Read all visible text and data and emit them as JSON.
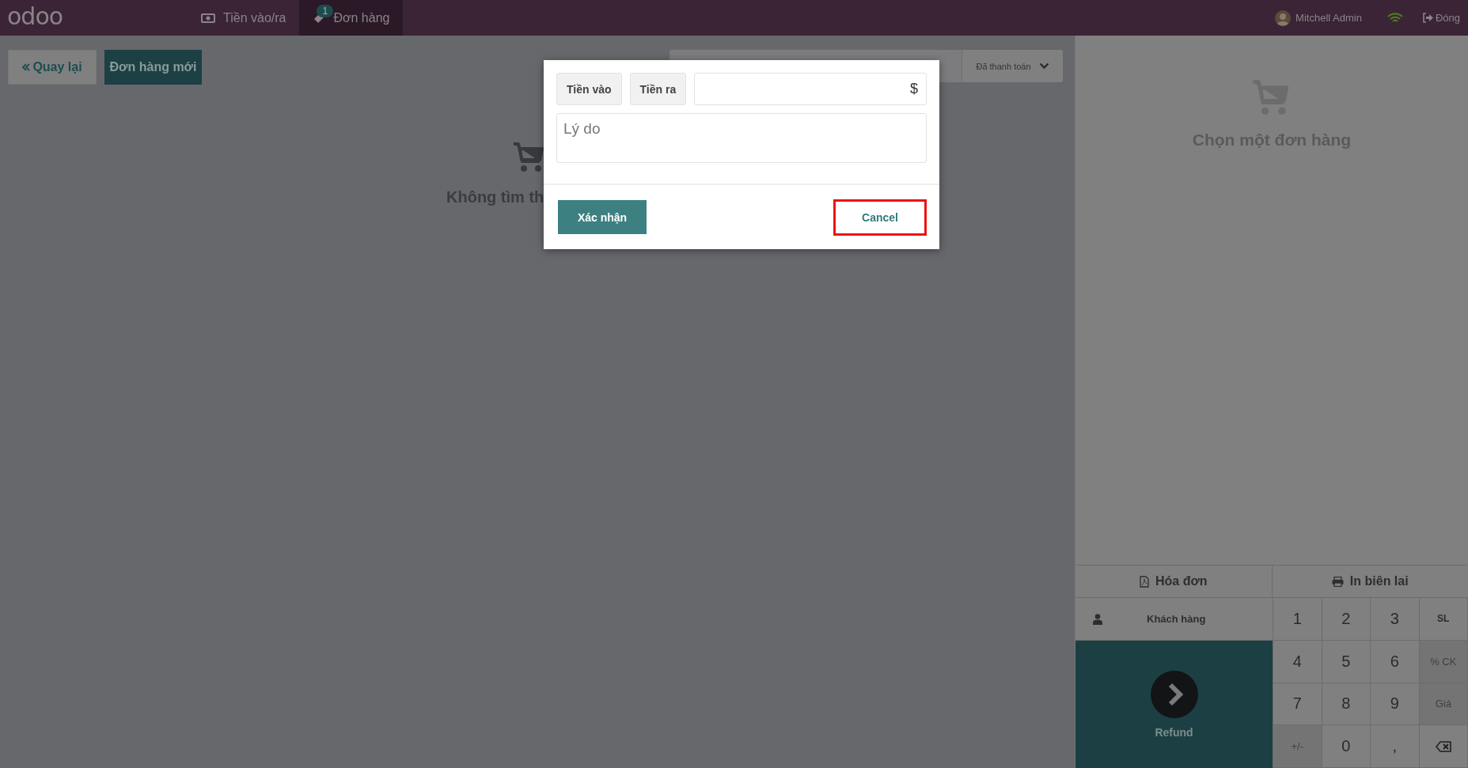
{
  "navbar": {
    "logo": "odoo",
    "items": [
      {
        "kind": "cash",
        "label": "Tiền vào/ra",
        "selected": false
      },
      {
        "kind": "orders",
        "label": "Đơn hàng",
        "badge": "1",
        "selected": true
      }
    ],
    "user": "Mitchell Admin",
    "close": "Đóng"
  },
  "toolbar": {
    "back": "Quay lại",
    "new_order": "Đơn hàng mới",
    "filter": "Đã thanh toán"
  },
  "order_list": {
    "empty_text": "Không tìm th"
  },
  "dialog": {
    "buttons": [
      {
        "label": "Tiền vào"
      },
      {
        "label": "Tiền ra"
      }
    ],
    "currency": "$",
    "reason_placeholder": "Lý do",
    "confirm": "Xác nhận",
    "cancel": "Cancel",
    "cancel_highlighted": true
  },
  "detail": {
    "empty_text": "Chọn một đơn hàng"
  },
  "actions": {
    "invoice": "Hóa đơn",
    "print": "In biên lai",
    "customer": "Khách hàng",
    "refund": "Refund"
  },
  "numpad": [
    {
      "kind": "key",
      "label": "1",
      "disabled": false
    },
    {
      "kind": "key",
      "label": "2",
      "disabled": false
    },
    {
      "kind": "key",
      "label": "3",
      "disabled": false
    },
    {
      "kind": "key",
      "label": "SL",
      "disabled": false
    },
    {
      "kind": "key",
      "label": "4",
      "disabled": false
    },
    {
      "kind": "key",
      "label": "5",
      "disabled": false
    },
    {
      "kind": "key",
      "label": "6",
      "disabled": false
    },
    {
      "kind": "key",
      "label": "% CK",
      "disabled": true
    },
    {
      "kind": "key",
      "label": "7",
      "disabled": false
    },
    {
      "kind": "key",
      "label": "8",
      "disabled": false
    },
    {
      "kind": "key",
      "label": "9",
      "disabled": false
    },
    {
      "kind": "key",
      "label": "Giá",
      "disabled": true
    },
    {
      "kind": "key",
      "label": "+/-",
      "disabled": true
    },
    {
      "kind": "key",
      "label": "0",
      "disabled": false
    },
    {
      "kind": "key",
      "label": ",",
      "disabled": false
    },
    {
      "kind": "backspace"
    }
  ]
}
